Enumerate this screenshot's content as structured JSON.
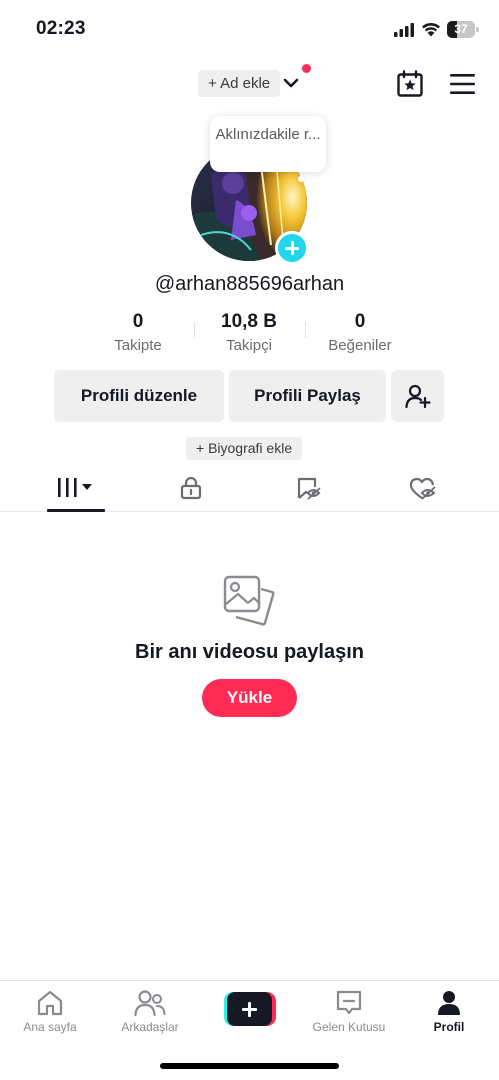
{
  "status_bar": {
    "time": "02:23",
    "battery_level": "37",
    "battery_fraction": 0.37,
    "icons": [
      "signal-icon",
      "wifi-icon",
      "battery-icon"
    ]
  },
  "header": {
    "add_name_label": "+ Ad ekle",
    "notification_dot_color": "#fe2c55",
    "icons": [
      "chevron-down-icon",
      "calendar-star-icon",
      "menu-icon"
    ]
  },
  "profile": {
    "bubble_text": "Aklınızdakile r...",
    "username": "@arhan885696arhan",
    "stats": [
      {
        "value": "0",
        "label": "Takipte"
      },
      {
        "value": "10,8 B",
        "label": "Takipçi"
      },
      {
        "value": "0",
        "label": "Beğeniler"
      }
    ],
    "buttons": {
      "edit": "Profili düzenle",
      "share": "Profili Paylaş"
    },
    "bio_label": "+ Biyografi ekle"
  },
  "tabs": {
    "items": [
      "videos-grid-icon",
      "lock-icon",
      "tagged-icon",
      "liked-icon"
    ],
    "active_index": 0
  },
  "empty_state": {
    "title": "Bir anı videosu paylaşın",
    "upload_label": "Yükle"
  },
  "bottom_nav": {
    "items": [
      {
        "label": "Ana sayfa",
        "icon": "home-icon"
      },
      {
        "label": "Arkadaşlar",
        "icon": "friends-icon"
      },
      {
        "label": "",
        "icon": "create-plus-icon"
      },
      {
        "label": "Gelen Kutusu",
        "icon": "inbox-icon"
      },
      {
        "label": "Profil",
        "icon": "profile-icon"
      }
    ],
    "active": "Profil"
  },
  "colors": {
    "accent": "#fe2c55",
    "cyan": "#20d5ec",
    "text": "#161823",
    "muted": "#6b6d72",
    "button_bg": "#efefef"
  }
}
